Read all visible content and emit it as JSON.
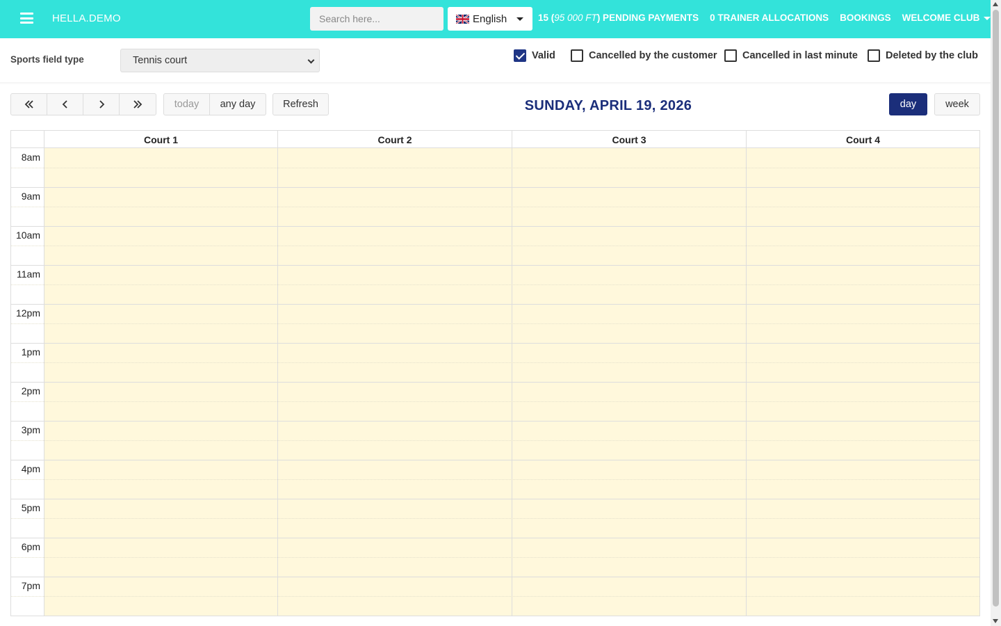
{
  "topbar": {
    "brand": "HELLA.DEMO",
    "search_placeholder": "Search here...",
    "language": "English",
    "language_flag": "uk-flag-icon",
    "pending_count": "15 (",
    "pending_amount": "95 000 FT",
    "pending_suffix": ") PENDING PAYMENTS",
    "trainer_allocations": "0 TRAINER ALLOCATIONS",
    "bookings": "BOOKINGS",
    "welcome": "WELCOME CLUB",
    "bg_color": "#33e3da"
  },
  "filters": {
    "sports_field_type_label": "Sports field type",
    "sports_field_type_value": "Tennis court",
    "checkboxes": [
      {
        "label": "Valid",
        "checked": true
      },
      {
        "label": "Cancelled by the customer",
        "checked": false
      },
      {
        "label": "Cancelled in last minute",
        "checked": false
      },
      {
        "label": "Deleted by the club",
        "checked": false
      }
    ]
  },
  "toolbar": {
    "today": "today",
    "any_day": "any day",
    "refresh": "Refresh",
    "day": "day",
    "week": "week",
    "active_view": "day"
  },
  "calendar": {
    "date_title": "SUNDAY, APRIL 19, 2026",
    "courts": [
      "Court 1",
      "Court 2",
      "Court 3",
      "Court 4"
    ],
    "hours": [
      "8am",
      "9am",
      "10am",
      "11am",
      "12pm",
      "1pm",
      "2pm",
      "3pm",
      "4pm",
      "5pm",
      "6pm",
      "7pm"
    ],
    "slot_color": "#fff8dc",
    "accent_color": "#1b2e7a"
  }
}
